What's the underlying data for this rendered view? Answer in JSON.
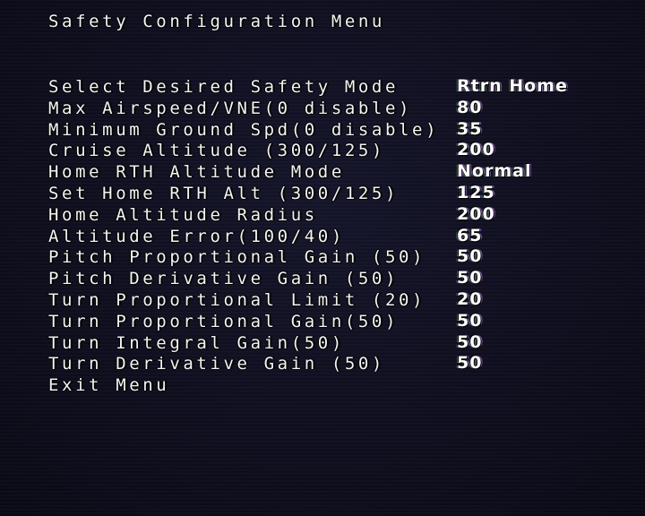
{
  "menu_title": "Safety Configuration Menu",
  "items": [
    {
      "label": "Select Desired Safety Mode",
      "value": "Rtrn Home"
    },
    {
      "label": "Max Airspeed/VNE(0 disable)",
      "value": "80"
    },
    {
      "label": "Minimum Ground Spd(0 disable)",
      "value": "35"
    },
    {
      "label": "Cruise Altitude (300/125)",
      "value": "200"
    },
    {
      "label": "Home RTH Altitude Mode",
      "value": "Normal"
    },
    {
      "label": "Set Home RTH Alt (300/125)",
      "value": "125"
    },
    {
      "label": "Home Altitude Radius",
      "value": "200"
    },
    {
      "label": "Altitude Error(100/40)",
      "value": "65"
    },
    {
      "label": "Pitch Proportional Gain (50)",
      "value": "50"
    },
    {
      "label": "Pitch Derivative Gain (50)",
      "value": "50"
    },
    {
      "label": "Turn Proportional Limit (20)",
      "value": "20"
    },
    {
      "label": "Turn Proportional Gain(50)",
      "value": "50"
    },
    {
      "label": "Turn Integral Gain(50)",
      "value": "50"
    },
    {
      "label": "Turn Derivative Gain (50)",
      "value": "50"
    }
  ],
  "exit_label": "Exit Menu"
}
